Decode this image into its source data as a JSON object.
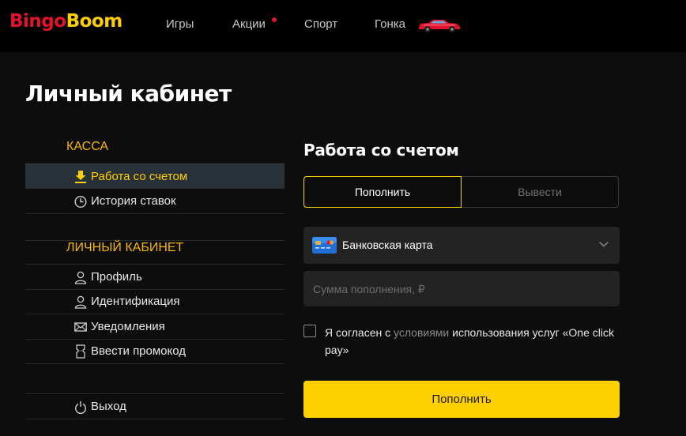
{
  "header": {
    "logo_part1": "Bingo",
    "logo_part2": "Boom",
    "nav": [
      {
        "label": "Игры"
      },
      {
        "label": "Акции",
        "has_dot": true
      },
      {
        "label": "Спорт"
      },
      {
        "label": "Гонка",
        "icon": "race-car-icon"
      }
    ]
  },
  "page": {
    "title": "Личный кабинет"
  },
  "sidebar": {
    "sections": [
      {
        "title": "КАССА",
        "items": [
          {
            "label": "Работа со счетом",
            "icon": "deposit-arrow-icon",
            "active": true
          },
          {
            "label": "История ставок",
            "icon": "clock-icon"
          }
        ]
      },
      {
        "title": "ЛИЧНЫЙ КАБИНЕТ",
        "items": [
          {
            "label": "Профиль",
            "icon": "user-icon"
          },
          {
            "label": "Идентификация",
            "icon": "user-icon"
          },
          {
            "label": "Уведомления",
            "icon": "envelope-icon"
          },
          {
            "label": "Ввести промокод",
            "icon": "ticket-icon"
          }
        ]
      }
    ],
    "logout": {
      "label": "Выход",
      "icon": "power-icon"
    }
  },
  "main": {
    "title": "Работа со счетом",
    "tabs": [
      {
        "label": "Пополнить",
        "active": true
      },
      {
        "label": "Вывести",
        "active": false
      }
    ],
    "payment_method": {
      "label": "Банковская карта",
      "icon": "bank-card-icon"
    },
    "amount": {
      "placeholder": "Сумма пополнения, ₽",
      "value": ""
    },
    "agreement": {
      "before": "Я согласен с ",
      "link": "условиями",
      "after": " использования услуг «One click pay»",
      "checked": false
    },
    "submit_label": "Пополнить"
  },
  "colors": {
    "accent": "#ffd000",
    "section_title": "#f5b800",
    "brand_red": "#e3132b",
    "background": "#0d0d0d",
    "input_bg": "#232323"
  }
}
